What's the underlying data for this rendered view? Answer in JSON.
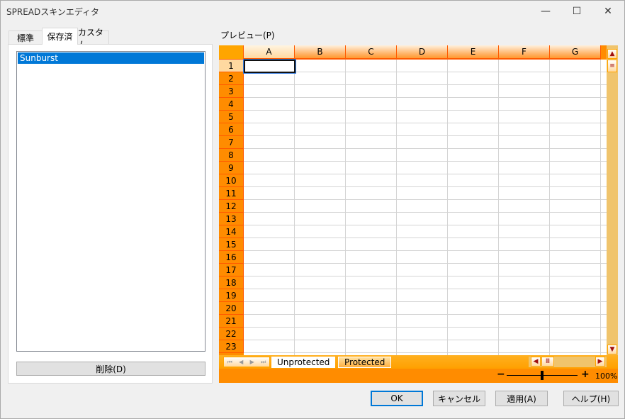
{
  "window": {
    "title": "SPREADスキンエディタ",
    "minimize_icon": "minimize-icon",
    "maximize_icon": "maximize-icon",
    "close_icon": "close-icon"
  },
  "tabs": [
    {
      "label": "標準"
    },
    {
      "label": "保存済",
      "selected": true
    },
    {
      "label": "カスタム"
    }
  ],
  "skin_list": {
    "items": [
      "Sunburst"
    ],
    "selected": "Sunburst"
  },
  "delete_button": "削除(D)",
  "preview": {
    "label": "プレビュー(P)",
    "columns": [
      "A",
      "B",
      "C",
      "D",
      "E",
      "F",
      "G"
    ],
    "rows": [
      "1",
      "2",
      "3",
      "4",
      "5",
      "6",
      "7",
      "8",
      "9",
      "10",
      "11",
      "12",
      "13",
      "14",
      "15",
      "16",
      "17",
      "18",
      "19",
      "20",
      "21",
      "22",
      "23"
    ],
    "active_cell": "A1",
    "sheet_tabs": [
      {
        "label": "Unprotected",
        "active": true
      },
      {
        "label": "Protected"
      }
    ],
    "zoom": {
      "minus": "−",
      "plus": "+",
      "value": "100%",
      "level_percent": 100
    },
    "colors": {
      "header": "#ff8c00",
      "accent": "#ff5a00",
      "scrollbar": "#f0c46c"
    }
  },
  "buttons": {
    "ok": "OK",
    "cancel": "キャンセル",
    "apply": "適用(A)",
    "help": "ヘルプ(H)"
  }
}
